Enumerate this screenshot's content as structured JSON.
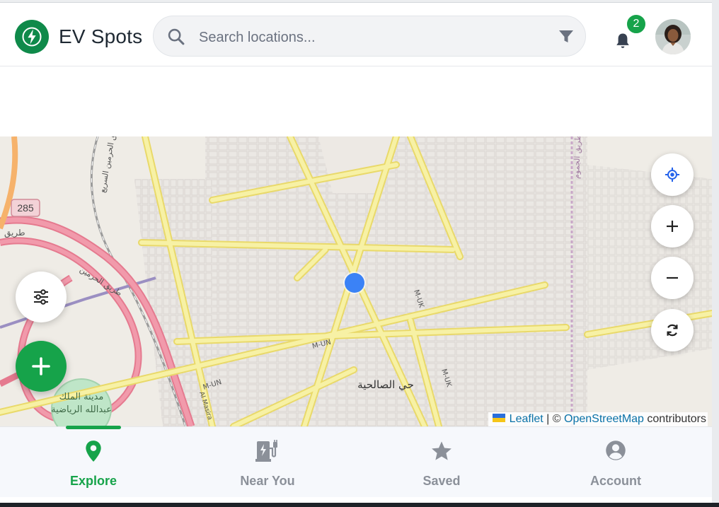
{
  "header": {
    "app_title": "EV Spots",
    "logo_icon": "bolt-icon",
    "search": {
      "placeholder": "Search locations...",
      "value": ""
    },
    "notifications": {
      "count": "2"
    },
    "brand_color": "#16a34a"
  },
  "map": {
    "labels": {
      "route_285": "285",
      "arabic_tariq": "طريق",
      "arabic_haramain": "طريق الحرمين",
      "arabic_haramain_top": "طريق الحرمين السريع",
      "arabic_city": "مدينة الملك",
      "arabic_city2": "عبدالله الرياضية",
      "arabic_district": "حي الصالحية",
      "arabic_east": "طريق الجموم",
      "road_mun": "M-UN",
      "road_mun2": "M-UN",
      "road_muk": "M-UK",
      "road_muk2": "M-UK",
      "road_almasira": "Al Masira"
    },
    "attribution": {
      "leaflet": "Leaflet",
      "separator": " | © ",
      "osm": "OpenStreetMap",
      "suffix": " contributors"
    }
  },
  "nav": {
    "items": [
      {
        "label": "Explore",
        "icon": "map-pin-icon",
        "active": true
      },
      {
        "label": "Near You",
        "icon": "ev-station-icon",
        "active": false
      },
      {
        "label": "Saved",
        "icon": "star-icon",
        "active": false
      },
      {
        "label": "Account",
        "icon": "account-icon",
        "active": false
      }
    ]
  }
}
